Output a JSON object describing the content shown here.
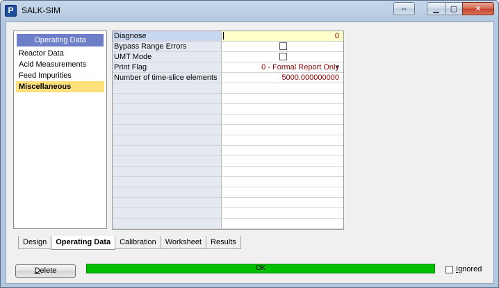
{
  "window": {
    "title": "SALK-SIM",
    "app_icon_glyph": "P"
  },
  "nav": {
    "header": "Operating Data",
    "items": [
      {
        "label": "Reactor Data",
        "selected": false
      },
      {
        "label": "Acid Measurements",
        "selected": false
      },
      {
        "label": "Feed Impurities",
        "selected": false
      },
      {
        "label": "Miscellaneous",
        "selected": true
      }
    ]
  },
  "grid": {
    "rows": [
      {
        "label": "Diagnose",
        "value": "0"
      },
      {
        "label": "Bypass Range Errors",
        "checked": false
      },
      {
        "label": "UMT Mode",
        "checked": false
      },
      {
        "label": "Print Flag",
        "value": "0 - Formal Report Only"
      },
      {
        "label": "Number of time-slice elements",
        "value": "5000.000000000"
      }
    ]
  },
  "tabs": [
    {
      "label": "Design",
      "active": false
    },
    {
      "label": "Operating Data",
      "active": true
    },
    {
      "label": "Calibration",
      "active": false
    },
    {
      "label": "Worksheet",
      "active": false
    },
    {
      "label": "Results",
      "active": false
    }
  ],
  "footer": {
    "delete_label_underlined": "D",
    "delete_label_rest": "elete",
    "status_text": "OK",
    "status_color": "#00c000",
    "ignored_label_underlined": "I",
    "ignored_label_rest": "gnored",
    "ignored_checked": false
  },
  "colors": {
    "nav_header": "#6c7fc8",
    "nav_selected": "#ffe07a",
    "value_text": "#8b0000",
    "active_value_cell": "#ffffcc"
  }
}
